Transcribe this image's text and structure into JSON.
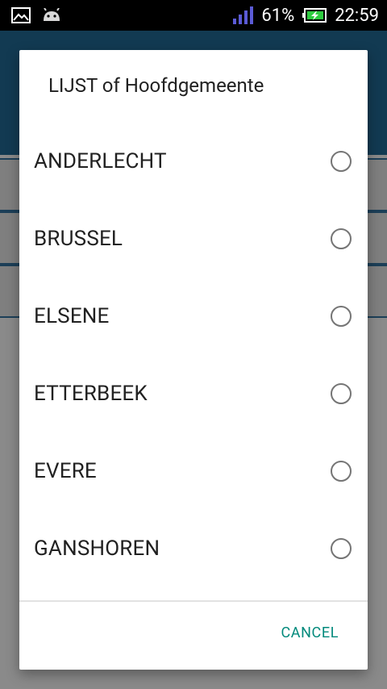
{
  "status_bar": {
    "battery_percent": "61%",
    "time": "22:59",
    "icons": [
      "image-icon",
      "android-debug-icon",
      "signal-icon",
      "battery-charging-icon"
    ]
  },
  "dialog": {
    "title": "LIJST of Hoofdgemeente",
    "items": [
      {
        "label": "ANDERLECHT",
        "selected": false
      },
      {
        "label": "BRUSSEL",
        "selected": false
      },
      {
        "label": "ELSENE",
        "selected": false
      },
      {
        "label": "ETTERBEEK",
        "selected": false
      },
      {
        "label": "EVERE",
        "selected": false
      },
      {
        "label": "GANSHOREN",
        "selected": false
      }
    ],
    "cancel_label": "CANCEL",
    "accent_color": "#00897b"
  }
}
